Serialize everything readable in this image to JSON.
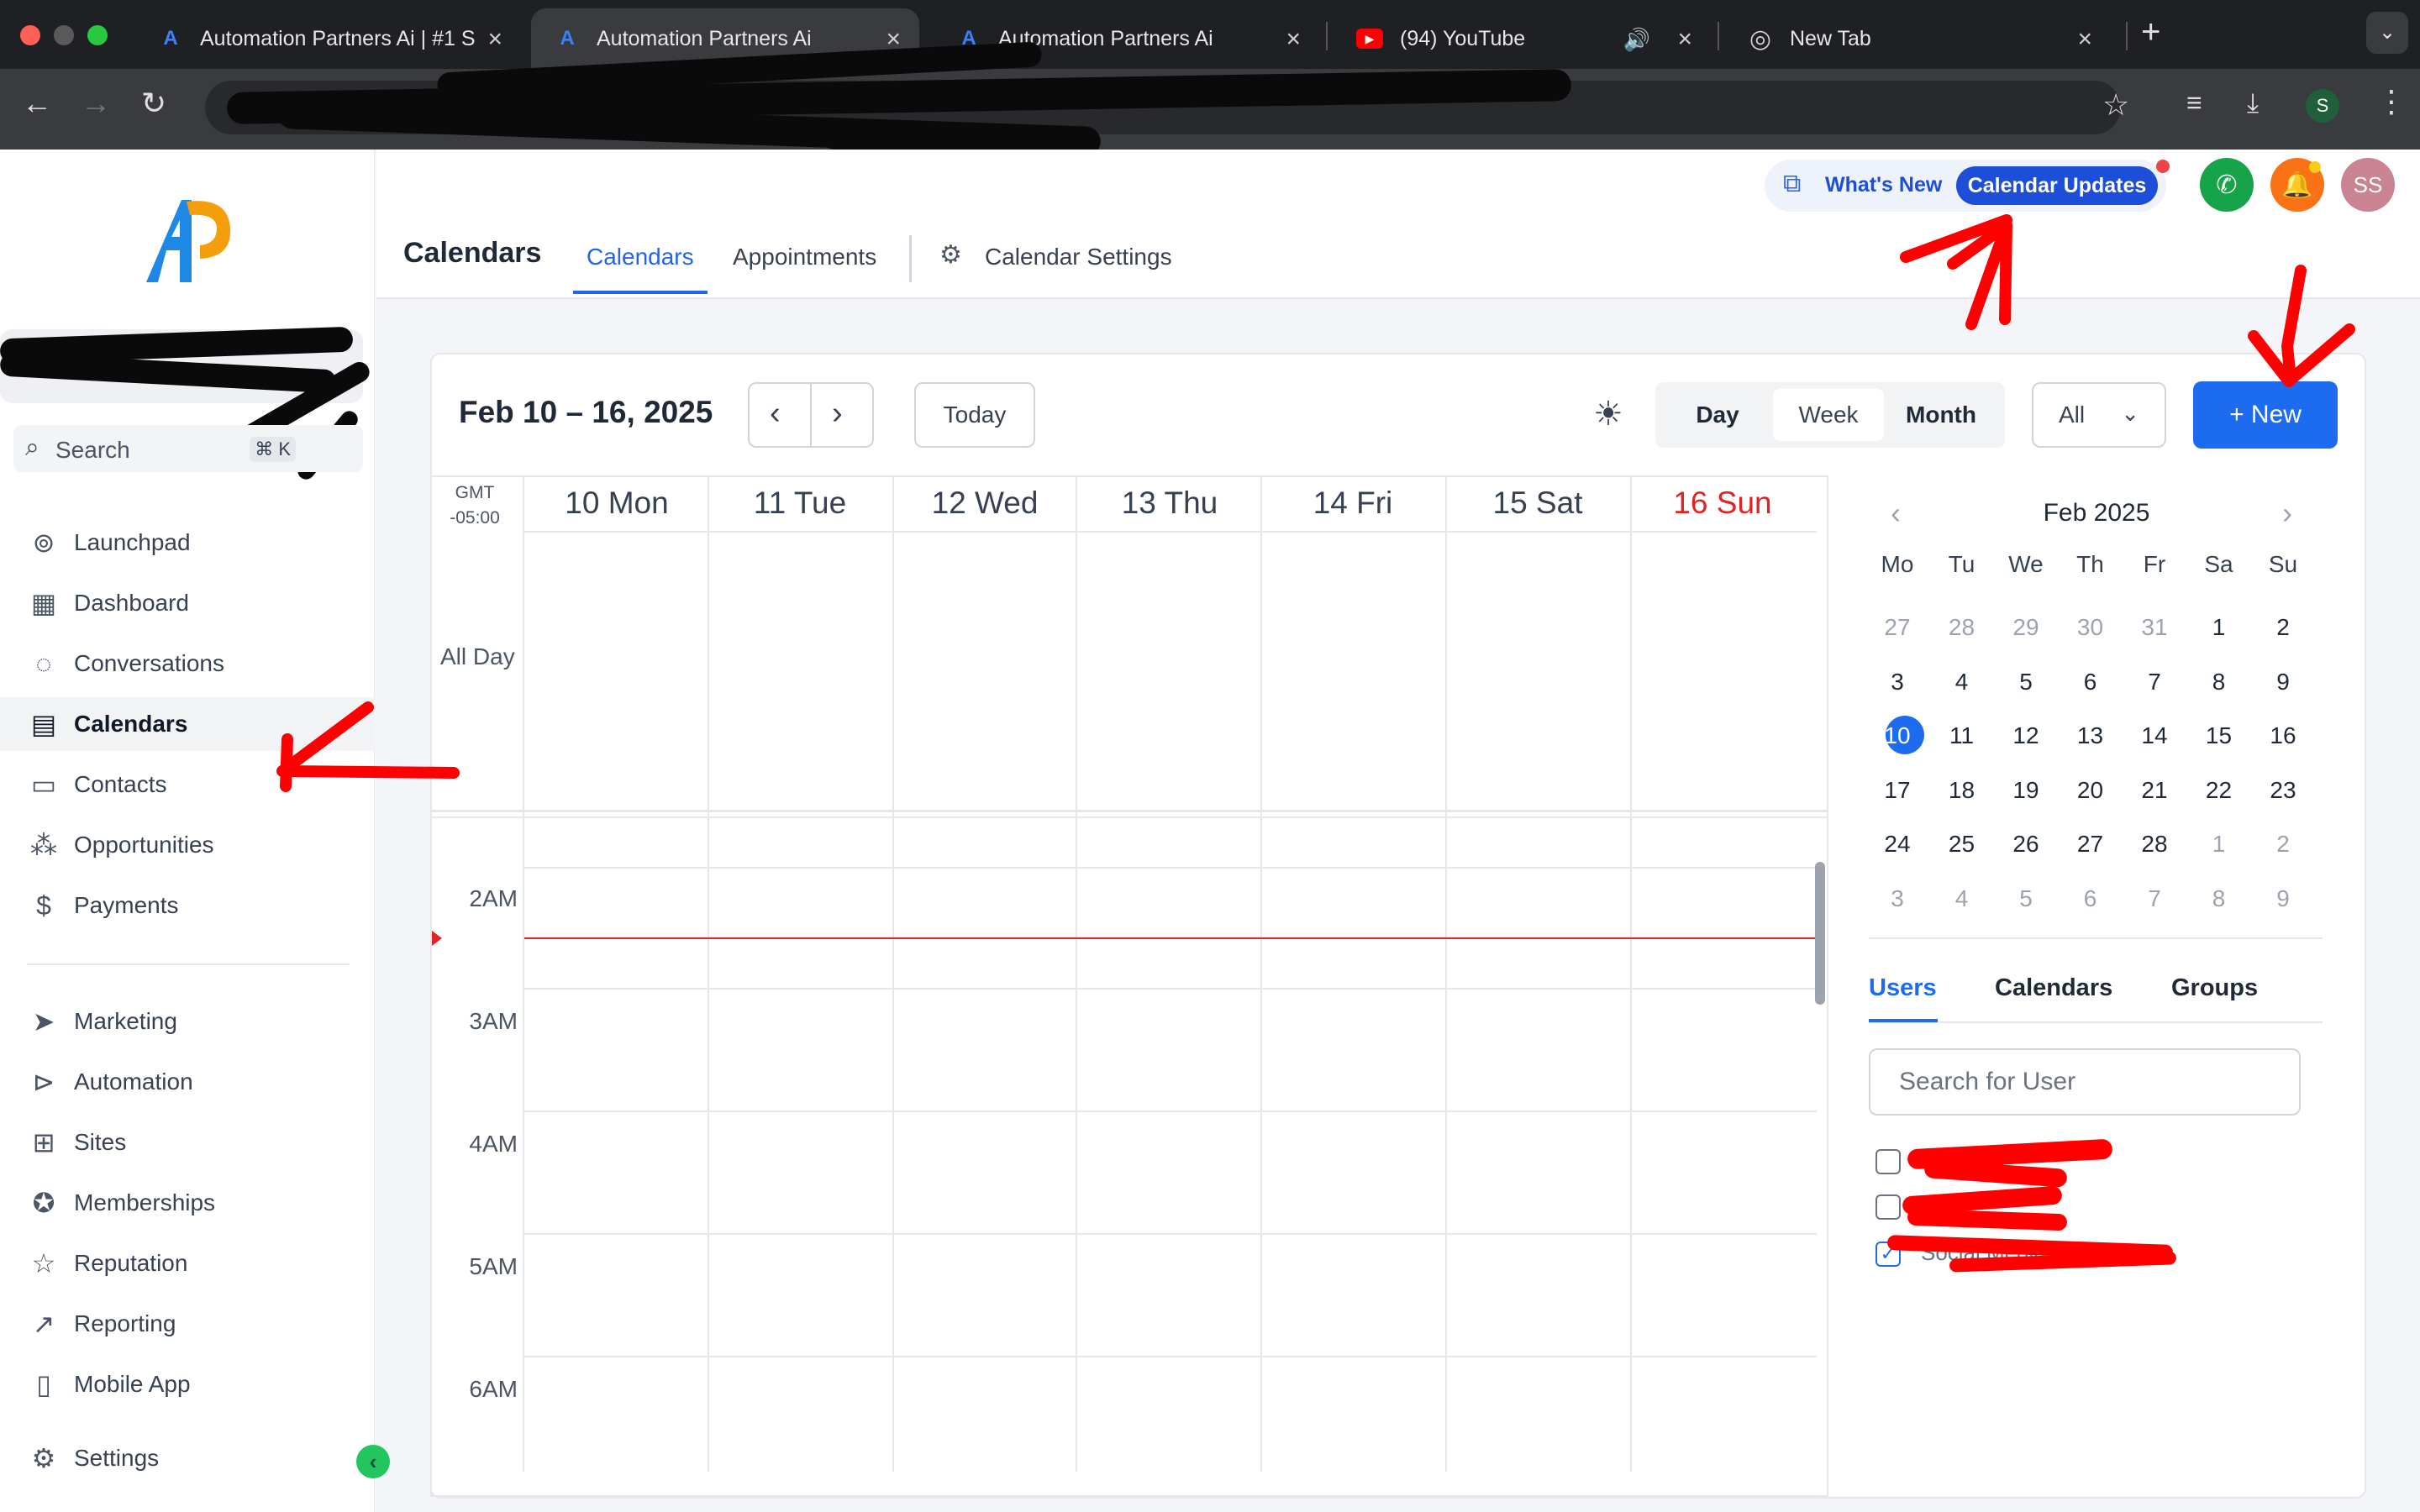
{
  "browser": {
    "tabs": [
      {
        "title": "Automation Partners Ai | #1 S",
        "icon": "app-logo-icon"
      },
      {
        "title": "Automation Partners Ai",
        "icon": "app-logo-icon"
      },
      {
        "title": "Automation Partners Ai",
        "icon": "app-logo-icon"
      },
      {
        "title": "(94) YouTube",
        "icon": "youtube-icon"
      },
      {
        "title": "New Tab",
        "icon": "chrome-icon"
      }
    ],
    "profile_initial": "S"
  },
  "sidebar": {
    "search_label": "Search",
    "search_shortcut": "⌘ K",
    "items": [
      {
        "label": "Launchpad",
        "icon": "launchpad-icon"
      },
      {
        "label": "Dashboard",
        "icon": "dashboard-icon"
      },
      {
        "label": "Conversations",
        "icon": "chat-icon"
      },
      {
        "label": "Calendars",
        "icon": "calendar-icon"
      },
      {
        "label": "Contacts",
        "icon": "contacts-icon"
      },
      {
        "label": "Opportunities",
        "icon": "opportunities-icon"
      },
      {
        "label": "Payments",
        "icon": "payments-icon"
      },
      {
        "label": "Marketing",
        "icon": "send-icon"
      },
      {
        "label": "Automation",
        "icon": "automation-icon"
      },
      {
        "label": "Sites",
        "icon": "sites-icon"
      },
      {
        "label": "Memberships",
        "icon": "badge-icon"
      },
      {
        "label": "Reputation",
        "icon": "star-icon"
      },
      {
        "label": "Reporting",
        "icon": "trend-icon"
      },
      {
        "label": "Mobile App",
        "icon": "phone-icon"
      },
      {
        "label": "Settings",
        "icon": "gear-icon"
      }
    ]
  },
  "header": {
    "title": "Calendars",
    "tabs": [
      "Calendars",
      "Appointments",
      "Calendar Settings"
    ],
    "whats_new": "What's New",
    "updates_pill": "Calendar Updates",
    "avatar": "SS"
  },
  "calendar": {
    "date_range": "Feb 10 – 16, 2025",
    "today_label": "Today",
    "views": [
      "Day",
      "Week",
      "Month"
    ],
    "selected_view": "Week",
    "filter": "All",
    "new_label": "+ New",
    "timezone": [
      "GMT",
      "-05:00"
    ],
    "days": [
      "10 Mon",
      "11 Tue",
      "12 Wed",
      "13 Thu",
      "14 Fri",
      "15 Sat",
      "16 Sun"
    ],
    "all_day_label": "All Day",
    "hours": [
      "2AM",
      "3AM",
      "4AM",
      "5AM",
      "6AM"
    ],
    "weekend_color": "#e02424"
  },
  "mini_calendar": {
    "month": "Feb 2025",
    "weekdays": [
      "Mo",
      "Tu",
      "We",
      "Th",
      "Fr",
      "Sa",
      "Su"
    ],
    "weeks": [
      [
        "27",
        "28",
        "29",
        "30",
        "31",
        "1",
        "2"
      ],
      [
        "3",
        "4",
        "5",
        "6",
        "7",
        "8",
        "9"
      ],
      [
        "10",
        "11",
        "12",
        "13",
        "14",
        "15",
        "16"
      ],
      [
        "17",
        "18",
        "19",
        "20",
        "21",
        "22",
        "23"
      ],
      [
        "24",
        "25",
        "26",
        "27",
        "28",
        "1",
        "2"
      ],
      [
        "3",
        "4",
        "5",
        "6",
        "7",
        "8",
        "9"
      ]
    ],
    "selected": "10"
  },
  "filter_panel": {
    "tabs": [
      "Users",
      "Calendars",
      "Groups"
    ],
    "search_placeholder": "Search for User",
    "visible_user_text": "Social Media Guy"
  },
  "colors": {
    "accent": "#1d6cf0",
    "annotation": "#ff0000"
  }
}
